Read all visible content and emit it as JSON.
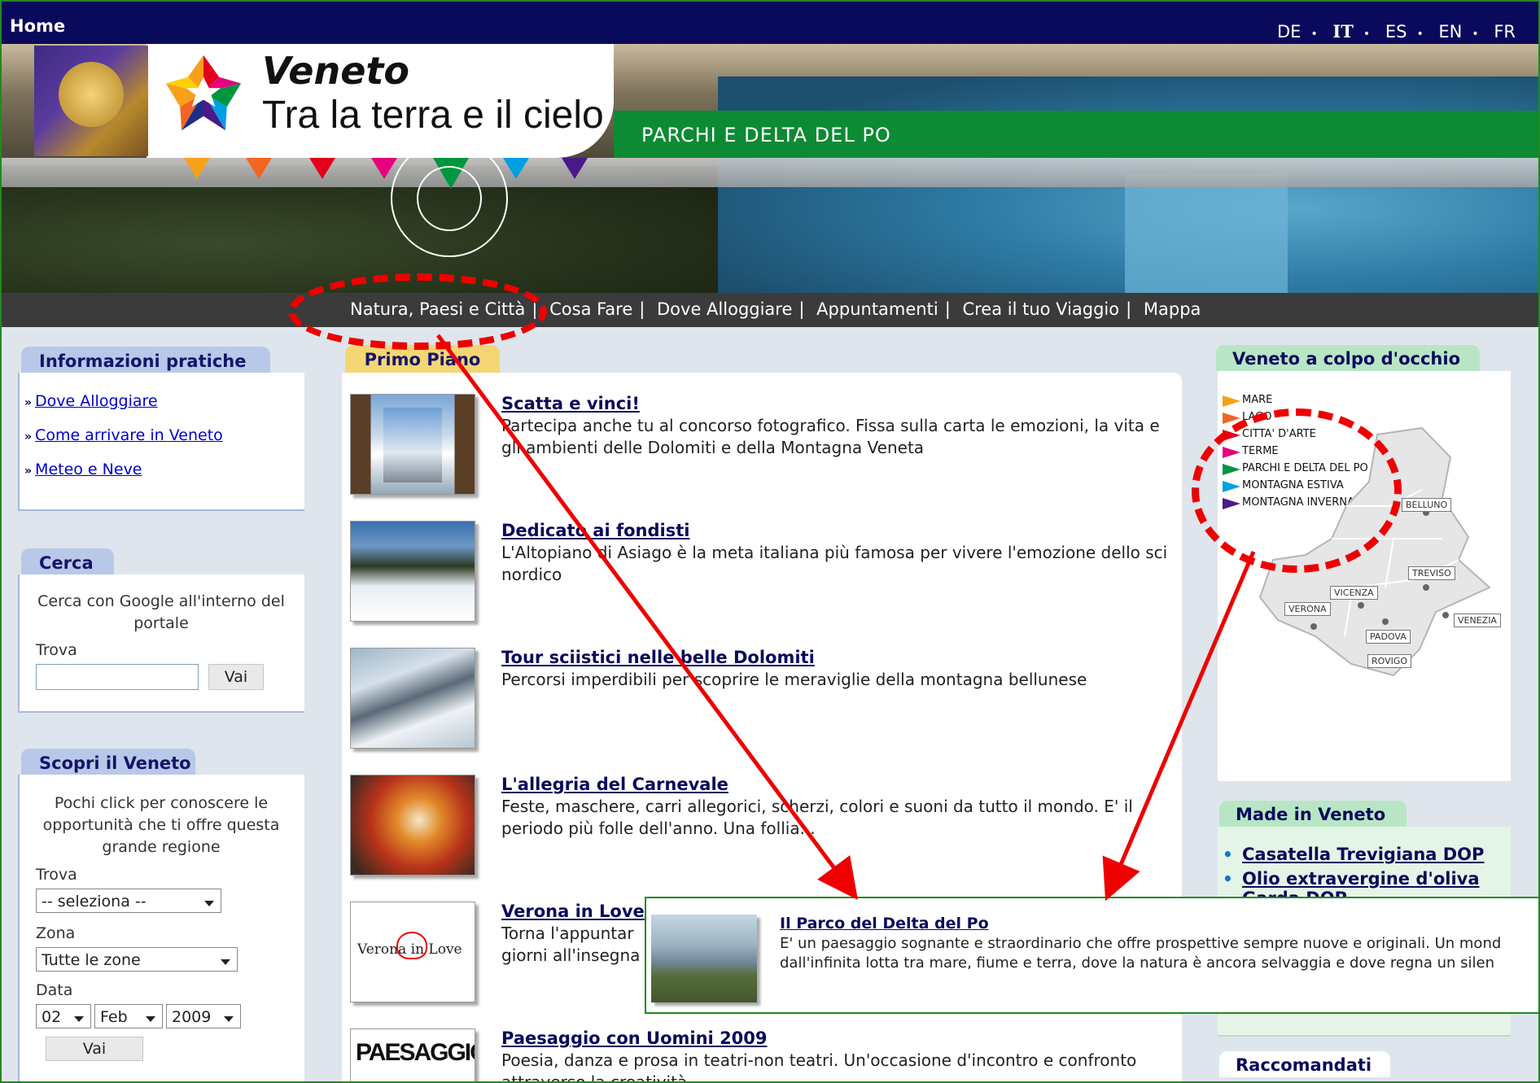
{
  "topbar": {
    "home": "Home",
    "langs": [
      "DE",
      "IT",
      "ES",
      "EN",
      "FR"
    ],
    "active_lang": "IT"
  },
  "banner": {
    "title": "Veneto",
    "subtitle": "Tra la terra e il cielo",
    "section": "PARCHI E DELTA DEL PO"
  },
  "nav": [
    "Natura, Paesi e Città",
    "Cosa Fare",
    "Dove Alloggiare",
    "Appuntamenti",
    "Crea il tuo Viaggio",
    "Mappa"
  ],
  "sidebar": {
    "info": {
      "title": "Informazioni pratiche",
      "links": [
        "Dove Alloggiare",
        "Come arrivare in Veneto",
        "Meteo e Neve"
      ]
    },
    "search": {
      "title": "Cerca",
      "desc": "Cerca con Google all'interno del portale",
      "label": "Trova",
      "button": "Vai"
    },
    "discover": {
      "title": "Scopri il Veneto",
      "desc": "Pochi click per conoscere le opportunità che ti offre questa grande regione",
      "trova_label": "Trova",
      "trova_value": "-- seleziona --",
      "zona_label": "Zona",
      "zona_value": "Tutte le zone",
      "data_label": "Data",
      "day": "02",
      "month": "Feb",
      "year": "2009",
      "button": "Vai"
    }
  },
  "main": {
    "tab": "Primo Piano",
    "articles": [
      {
        "title": "Scatta e vinci!",
        "desc": "Partecipa anche tu al concorso fotografico. Fissa sulla carta le emozioni, la vita e gli ambienti delle Dolomiti e della Montagna Veneta"
      },
      {
        "title": "Dedicato ai fondisti",
        "desc": "L'Altopiano di Asiago è la meta italiana più famosa per vivere l'emozione dello sci nordico"
      },
      {
        "title": "Tour sciistici nelle belle Dolomiti",
        "desc": "Percorsi imperdibili per scoprire le meraviglie della montagna bellunese"
      },
      {
        "title": "L'allegria del Carnevale",
        "desc": "Feste, maschere, carri allegorici, scherzi, colori e suoni da tutto il mondo. E' il periodo più folle dell'anno. Una follia..."
      },
      {
        "title": "Verona in Love",
        "desc": "Torna l'appuntar giorni all'insegna",
        "thumb_text": "Verona in Love"
      },
      {
        "title": "Paesaggio con Uomini 2009",
        "desc": "Poesia, danza e prosa in teatri-non teatri. Un'occasione d'incontro e confronto attraverso la creatività",
        "thumb_text": "PAESAGGIO"
      }
    ]
  },
  "right": {
    "glance": {
      "title": "Veneto a colpo d'occhio",
      "legend": [
        {
          "label": "MARE",
          "color": "#f7a11a"
        },
        {
          "label": "LAGO",
          "color": "#f26522"
        },
        {
          "label": "CITTA' D'ARTE",
          "color": "#e2001a"
        },
        {
          "label": "TERME",
          "color": "#e6007e"
        },
        {
          "label": "PARCHI E DELTA DEL PO",
          "color": "#00963f"
        },
        {
          "label": "MONTAGNA ESTIVA",
          "color": "#009fe3"
        },
        {
          "label": "MONTAGNA INVERNALE",
          "color": "#4a1a8a"
        }
      ],
      "cities": [
        "BELLUNO",
        "TREVISO",
        "VICENZA",
        "VERONA",
        "VENEZIA",
        "PADOVA",
        "ROVIGO"
      ]
    },
    "made": {
      "title": "Made in Veneto",
      "items": [
        "Casatella Trevigiana DOP",
        "Olio extravergine d'oliva",
        "Garda DOP"
      ]
    },
    "recommended": {
      "title": "Raccomandati"
    }
  },
  "tooltip": {
    "title": "Il Parco del Delta del Po",
    "line1": "E' un paesaggio sognante e straordinario che offre prospettive sempre nuove e originali. Un mond",
    "line2": "dall'infinita lotta tra mare, fiume e terra, dove la natura è ancora selvaggia e dove regna un silen"
  },
  "colors": {
    "topbar": "#0a0a5c",
    "green": "#0d8a34",
    "nav": "#3b3b3b",
    "annotation": "#ee0000"
  }
}
